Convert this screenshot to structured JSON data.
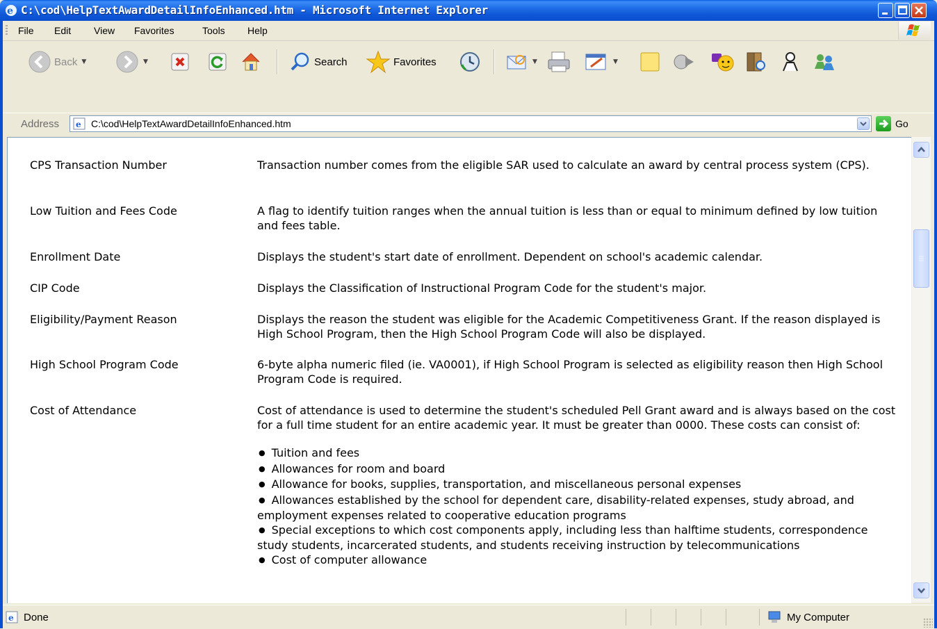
{
  "window": {
    "title": "C:\\cod\\HelpTextAwardDetailInfoEnhanced.htm - Microsoft Internet Explorer"
  },
  "menu": [
    "File",
    "Edit",
    "View",
    "Favorites",
    "Tools",
    "Help"
  ],
  "toolbar": {
    "back_label": "Back",
    "search_label": "Search",
    "favorites_label": "Favorites"
  },
  "address": {
    "label": "Address",
    "url": "C:\\cod\\HelpTextAwardDetailInfoEnhanced.htm",
    "go_label": "Go"
  },
  "content": {
    "rows": [
      {
        "term": "CPS Transaction Number",
        "definition": "Transaction number comes from the eligible SAR used to calculate an award by central process system (CPS)."
      },
      {
        "term": "Low Tuition and Fees Code",
        "definition": "A flag to identify tuition ranges when the annual tuition is less than or equal to minimum defined by low tuition and fees table."
      },
      {
        "term": "Enrollment Date",
        "definition": "Displays the student's start date of enrollment. Dependent on school's academic calendar."
      },
      {
        "term": "CIP Code",
        "definition": "Displays the Classification of Instructional Program Code for the student's major."
      },
      {
        "term": "Eligibility/Payment Reason",
        "definition": "Displays the reason the student was eligible for the Academic Competitiveness Grant. If the reason displayed is High School Program, then the High School Program Code will also be displayed."
      },
      {
        "term": "High School Program Code",
        "definition": "6-byte alpha numeric filed (ie. VA0001), if High School Program is selected as eligibility reason then High School Program Code is required."
      },
      {
        "term": "Cost of Attendance",
        "definition": "Cost of attendance is used to determine the student's scheduled Pell Grant award and is always based on the cost for a full time student for an entire academic year. It must be greater than 0000. These costs can consist of:",
        "bullets": [
          "Tuition and fees",
          "Allowances for room and board",
          "Allowance for books, supplies, transportation, and miscellaneous personal expenses",
          "Allowances established by the school for dependent care, disability-related expenses, study abroad, and employment expenses related to cooperative education programs",
          "Special exceptions to which cost components apply, including less than halftime students, correspondence study students, incarcerated students, and students receiving instruction by telecommunications",
          "Cost of computer allowance"
        ]
      }
    ]
  },
  "status": {
    "text": "Done",
    "zone": "My Computer"
  },
  "icons": [
    "ie-icon",
    "minimize-icon",
    "maximize-icon",
    "close-icon",
    "windows-logo-icon",
    "back-icon",
    "forward-icon",
    "stop-icon",
    "refresh-icon",
    "home-icon",
    "search-icon",
    "favorites-star-icon",
    "history-icon",
    "mail-icon",
    "print-icon",
    "edit-icon",
    "note-icon",
    "media-icon",
    "messenger-icon",
    "research-icon",
    "user-icon",
    "contacts-icon",
    "go-arrow-icon",
    "computer-icon"
  ]
}
